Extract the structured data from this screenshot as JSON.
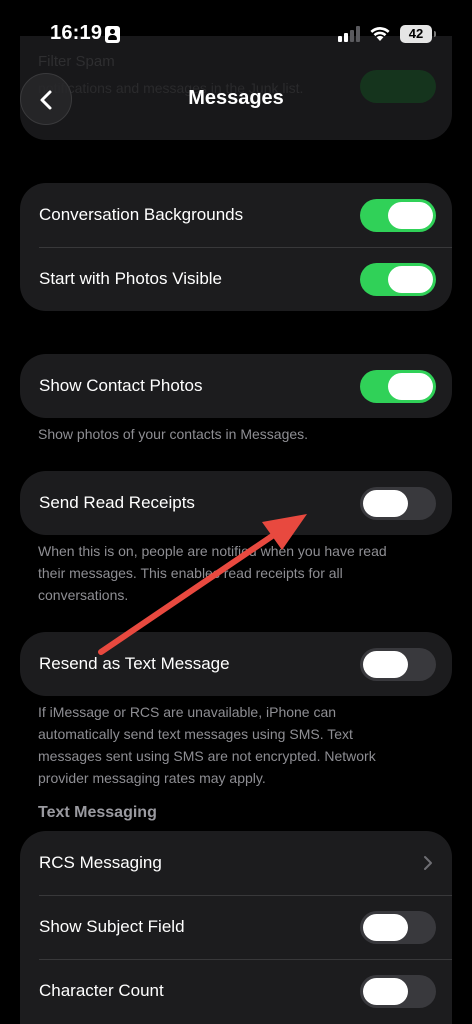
{
  "status_bar": {
    "time": "16:19",
    "battery": "42",
    "icons": [
      "id-card-icon",
      "signal-icon",
      "wifi-icon",
      "battery-icon"
    ]
  },
  "background_hint": {
    "title": "Filter Spam",
    "subtitle": "notifications and messages in the Junk list."
  },
  "nav": {
    "title": "Messages",
    "back_icon": "chevron-left-icon"
  },
  "group_backgrounds": {
    "rows": [
      {
        "label": "Conversation Backgrounds",
        "toggle": "on"
      },
      {
        "label": "Start with Photos Visible",
        "toggle": "on"
      }
    ]
  },
  "group_contact_photos": {
    "label": "Show Contact Photos",
    "toggle": "on",
    "footnote": "Show photos of your contacts in Messages."
  },
  "group_read_receipts": {
    "label": "Send Read Receipts",
    "toggle": "off",
    "footnote_lines": [
      "When this is on, people are notified when you have read",
      "their messages. This enables read receipts for all",
      "conversations."
    ]
  },
  "group_resend": {
    "label": "Resend as Text Message",
    "toggle": "off",
    "footnote_lines": [
      "If iMessage or RCS are unavailable, iPhone can",
      "automatically send text messages using SMS. Text",
      "messages sent using SMS are not encrypted. Network",
      "provider messaging rates may apply."
    ]
  },
  "text_messaging": {
    "header": "Text Messaging",
    "rows": [
      {
        "label": "RCS Messaging",
        "type": "disclosure",
        "icon": "chevron-right-icon"
      },
      {
        "label": "Show Subject Field",
        "toggle": "off"
      },
      {
        "label": "Character Count",
        "toggle": "off"
      }
    ]
  },
  "colors": {
    "background": "#000000",
    "card": "#1c1c1e",
    "toggle_on": "#30d158",
    "toggle_off": "#39393d",
    "footnote": "#8e8e93",
    "annotation_arrow": "#e8493f"
  }
}
